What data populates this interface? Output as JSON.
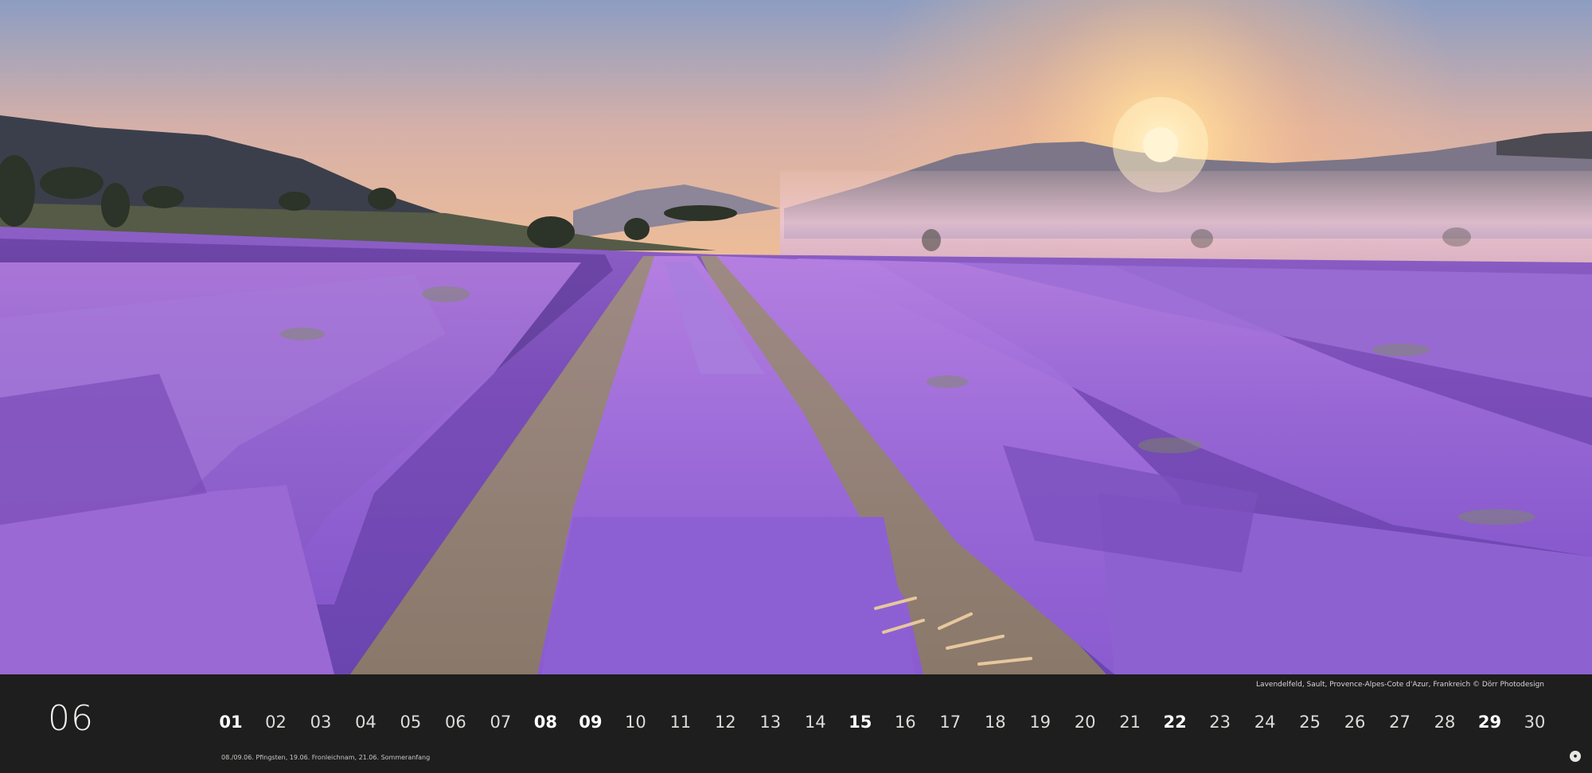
{
  "photo": {
    "subject": "lavender-field-sunrise",
    "colors": {
      "sky_top": "#8fa0c4",
      "sky_mid": "#e8b79a",
      "sky_glow": "#ffcf8a",
      "lavender_light": "#b07de0",
      "lavender_dark": "#5e3a9c",
      "path": "#8f7e70",
      "hill": "#3d4150"
    }
  },
  "calendar": {
    "month": "06",
    "credit": "Lavendelfeld, Sault, Provence-Alpes-Cote d'Azur, Frankreich © Dörr Photodesign",
    "holidays": "08./09.06. Pfingsten, 19.06. Fronleichnam, 21.06. Sommeranfang",
    "days": [
      {
        "label": "01",
        "sunday": true
      },
      {
        "label": "02",
        "sunday": false
      },
      {
        "label": "03",
        "sunday": false
      },
      {
        "label": "04",
        "sunday": false
      },
      {
        "label": "05",
        "sunday": false
      },
      {
        "label": "06",
        "sunday": false
      },
      {
        "label": "07",
        "sunday": false
      },
      {
        "label": "08",
        "sunday": true
      },
      {
        "label": "09",
        "sunday": true
      },
      {
        "label": "10",
        "sunday": false
      },
      {
        "label": "11",
        "sunday": false
      },
      {
        "label": "12",
        "sunday": false
      },
      {
        "label": "13",
        "sunday": false
      },
      {
        "label": "14",
        "sunday": false
      },
      {
        "label": "15",
        "sunday": true
      },
      {
        "label": "16",
        "sunday": false
      },
      {
        "label": "17",
        "sunday": false
      },
      {
        "label": "18",
        "sunday": false
      },
      {
        "label": "19",
        "sunday": false
      },
      {
        "label": "20",
        "sunday": false
      },
      {
        "label": "21",
        "sunday": false
      },
      {
        "label": "22",
        "sunday": true
      },
      {
        "label": "23",
        "sunday": false
      },
      {
        "label": "24",
        "sunday": false
      },
      {
        "label": "25",
        "sunday": false
      },
      {
        "label": "26",
        "sunday": false
      },
      {
        "label": "27",
        "sunday": false
      },
      {
        "label": "28",
        "sunday": false
      },
      {
        "label": "29",
        "sunday": true
      },
      {
        "label": "30",
        "sunday": false
      }
    ],
    "publisher_logo": "publisher-logo"
  }
}
